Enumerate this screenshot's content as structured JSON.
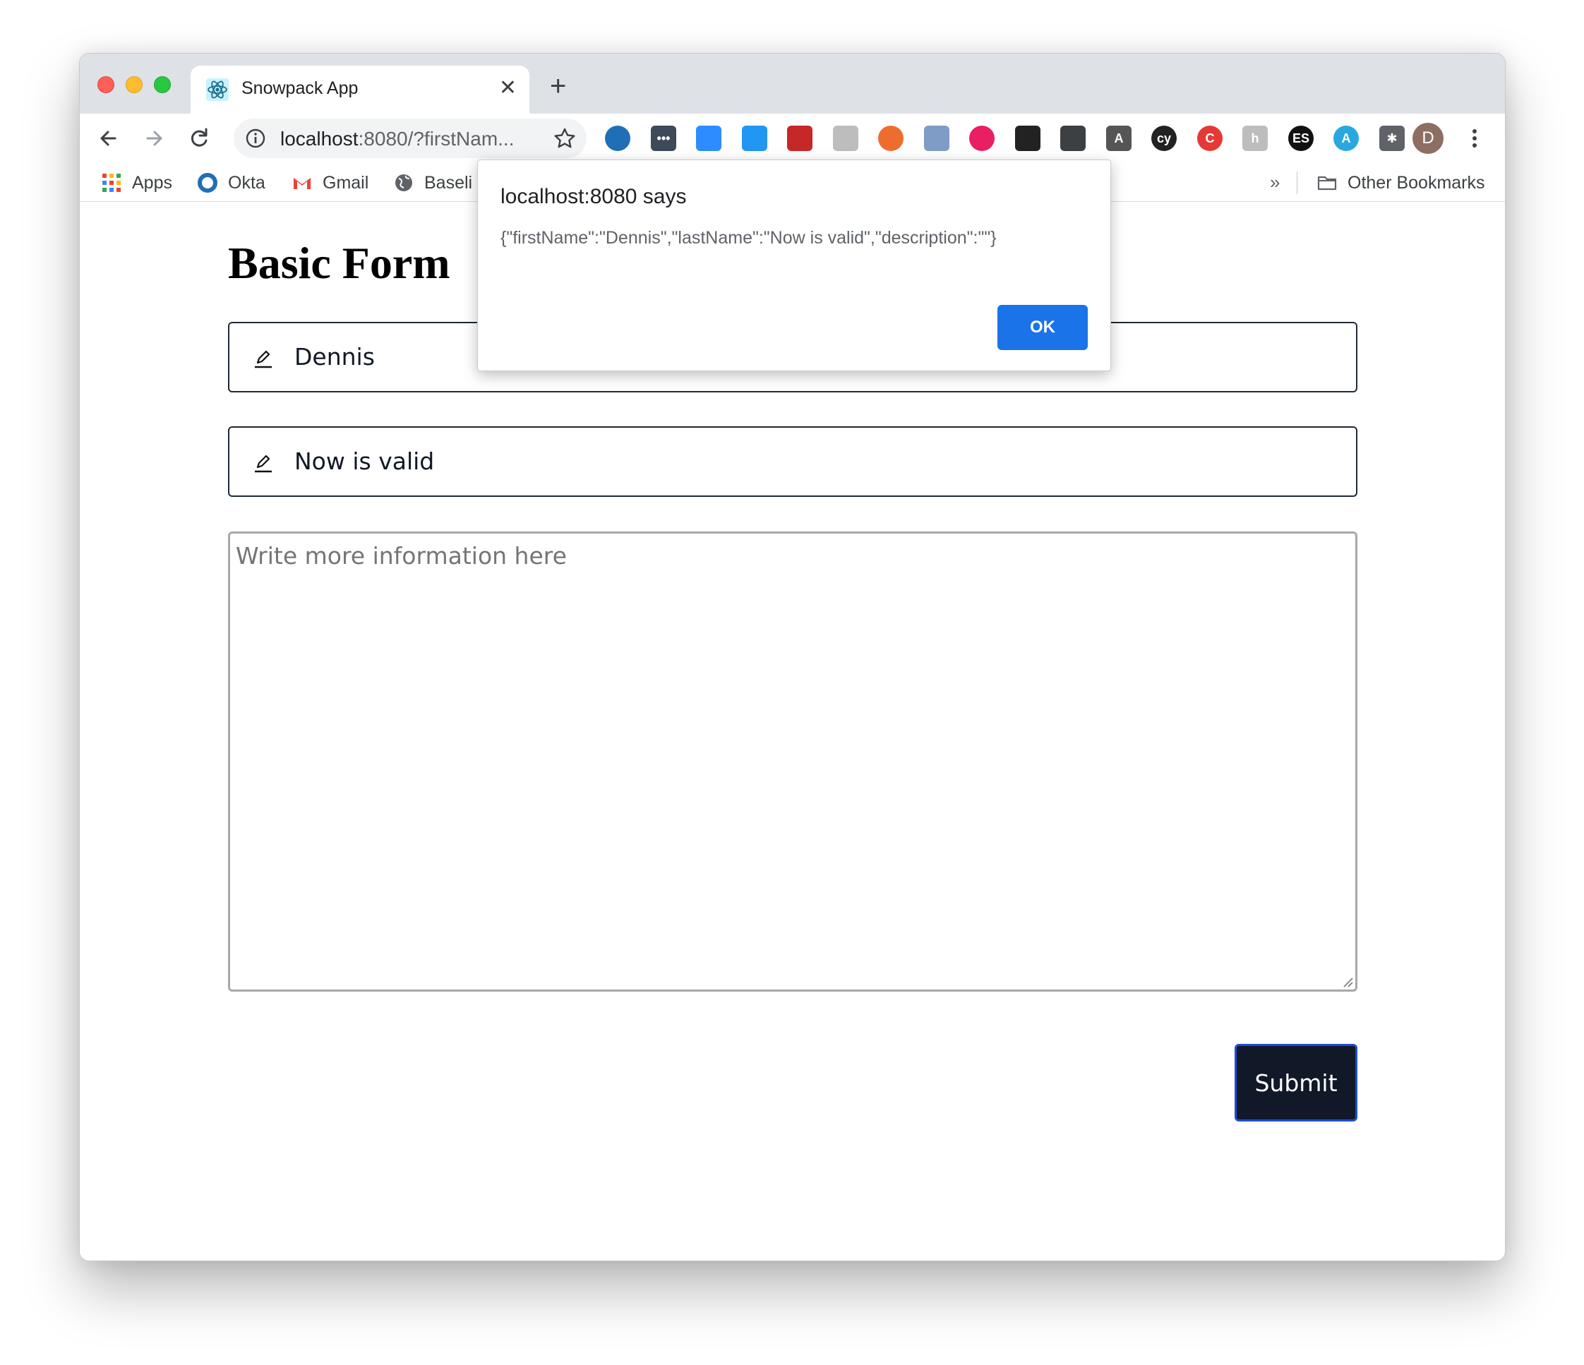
{
  "browser": {
    "tab": {
      "title": "Snowpack App",
      "close_glyph": "✕"
    },
    "new_tab_glyph": "+",
    "address": {
      "host": "localhost",
      "rest": ":8080/?firstNam..."
    },
    "avatar_letter": "D",
    "bookmarks": [
      {
        "label": "Apps",
        "icon": "apps-grid-icon"
      },
      {
        "label": "Okta",
        "icon": "okta-icon"
      },
      {
        "label": "Gmail",
        "icon": "gmail-icon"
      },
      {
        "label": "Baseli",
        "icon": "globe-icon"
      }
    ],
    "bookmarks_overflow": "»",
    "other_bookmarks": "Other Bookmarks",
    "extensions": [
      {
        "name": "okta-ext-icon",
        "glyph": "",
        "color": "#1f6fb6"
      },
      {
        "name": "dots-ext-icon",
        "glyph": "•••",
        "color": "#3c4a5a"
      },
      {
        "name": "zoom-ext-icon",
        "glyph": "",
        "color": "#2d8cff"
      },
      {
        "name": "window-ext-icon",
        "glyph": "",
        "color": "#2196f3"
      },
      {
        "name": "react-devtools-ext-icon",
        "glyph": "",
        "color": "#c62828"
      },
      {
        "name": "target-ext-icon",
        "glyph": "",
        "color": "#bdbdbd"
      },
      {
        "name": "lifebuoy-ext-icon",
        "glyph": "",
        "color": "#ef6c2f"
      },
      {
        "name": "moon-ext-icon",
        "glyph": "",
        "color": "#7f9cc7"
      },
      {
        "name": "color-wheel-ext-icon",
        "glyph": "",
        "color": "#e91e63"
      },
      {
        "name": "eye-ext-icon",
        "glyph": "",
        "color": "#222222"
      },
      {
        "name": "video-ext-icon",
        "glyph": "",
        "color": "#3c4043"
      },
      {
        "name": "font-ext-icon",
        "glyph": "A",
        "color": "#555555"
      },
      {
        "name": "cypress-ext-icon",
        "glyph": "cy",
        "color": "#222222"
      },
      {
        "name": "c-ext-icon",
        "glyph": "C",
        "color": "#e53935"
      },
      {
        "name": "h-ext-icon",
        "glyph": "h",
        "color": "#bdbdbd"
      },
      {
        "name": "es-ext-icon",
        "glyph": "ES",
        "color": "#111111"
      },
      {
        "name": "appstore-ext-icon",
        "glyph": "A",
        "color": "#29a8e0"
      },
      {
        "name": "puzzle-ext-icon",
        "glyph": "✱",
        "color": "#5f6368"
      }
    ]
  },
  "page": {
    "title": "Basic Form",
    "first_name_value": "Dennis",
    "last_name_value": "Now is valid",
    "description_placeholder": "Write more information here",
    "submit_label": "Submit"
  },
  "dialog": {
    "title": "localhost:8080 says",
    "message": "{\"firstName\":\"Dennis\",\"lastName\":\"Now is valid\",\"description\":\"\"}",
    "ok_label": "OK"
  },
  "colors": {
    "accent": "#1a73e8",
    "submit_bg": "#111827",
    "submit_border": "#1d4ed8"
  }
}
